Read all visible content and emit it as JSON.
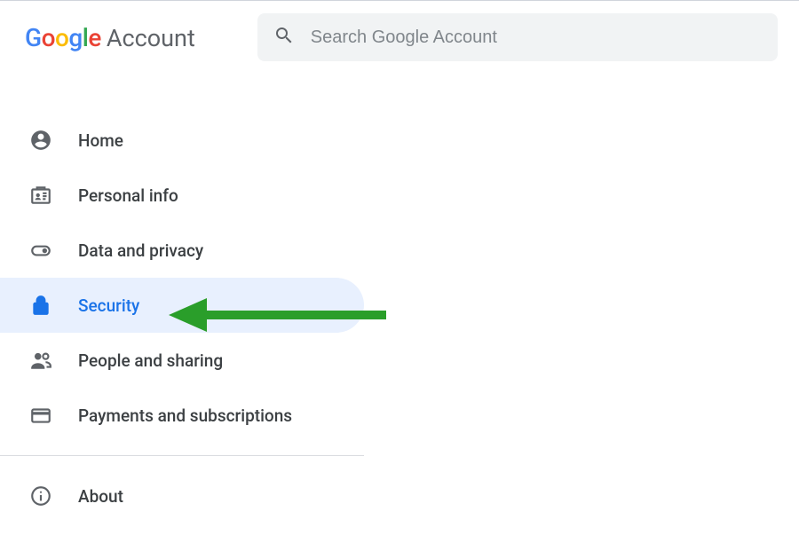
{
  "header": {
    "logo_text": "Google",
    "product_text": "Account"
  },
  "search": {
    "placeholder": "Search Google Account",
    "value": ""
  },
  "sidebar": {
    "items": [
      {
        "label": "Home"
      },
      {
        "label": "Personal info"
      },
      {
        "label": "Data and privacy"
      },
      {
        "label": "Security",
        "selected": true
      },
      {
        "label": "People and sharing"
      },
      {
        "label": "Payments and subscriptions"
      }
    ],
    "footer": [
      {
        "label": "About"
      }
    ]
  },
  "colors": {
    "accent": "#1a73e8",
    "selected_bg": "#e8f0fe",
    "annotation_arrow": "#2a9e2a"
  }
}
